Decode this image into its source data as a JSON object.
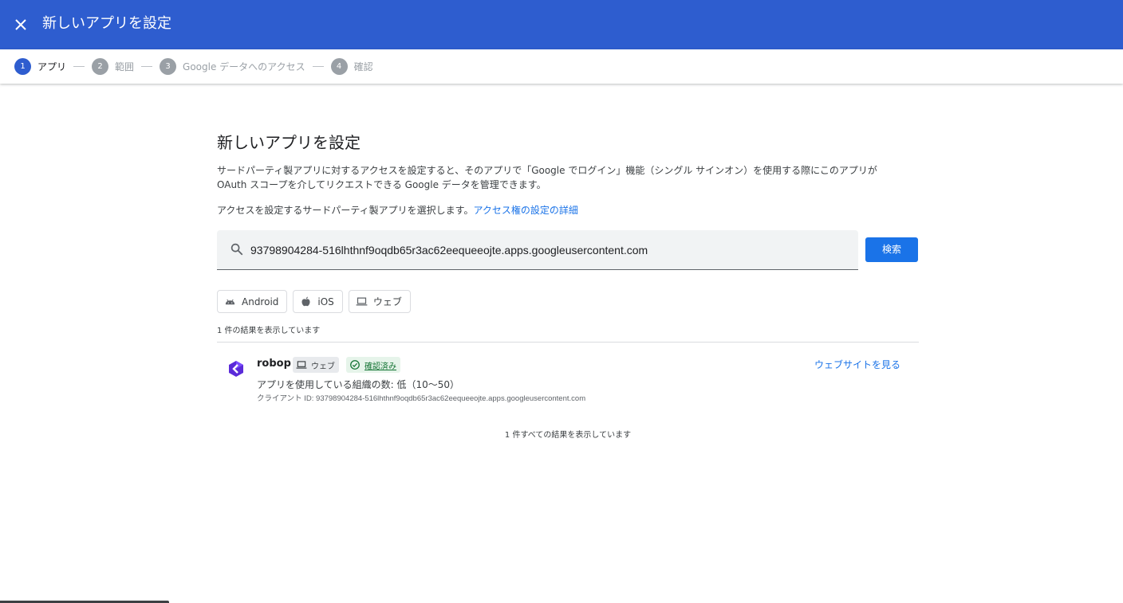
{
  "header": {
    "title": "新しいアプリを設定",
    "bg_color": "#2e5dcf"
  },
  "stepper": {
    "steps": [
      {
        "num": "1",
        "label": "アプリ",
        "active": true
      },
      {
        "num": "2",
        "label": "範囲",
        "active": false
      },
      {
        "num": "3",
        "label": "Google データへのアクセス",
        "active": false
      },
      {
        "num": "4",
        "label": "確認",
        "active": false
      }
    ]
  },
  "main": {
    "title": "新しいアプリを設定",
    "description_line1": "サードパーティ製アプリに対するアクセスを設定すると、そのアプリで「Google でログイン」機能（シングル サインオン）を使用する際にこのアプリが",
    "description_line2": "OAuth スコープを介してリクエストできる Google データを管理できます。",
    "select_text": "アクセスを設定するサードパーティ製アプリを選択します。",
    "select_link": "アクセス権の設定の詳細"
  },
  "search": {
    "value": "93798904284-516lhthnf9oqdb65r3ac62eequeeojte.apps.googleusercontent.com",
    "button_label": "検索"
  },
  "filters": [
    {
      "label": "Android",
      "icon": "android-icon"
    },
    {
      "label": "iOS",
      "icon": "apple-icon"
    },
    {
      "label": "ウェブ",
      "icon": "laptop-icon"
    }
  ],
  "result_count": "1 件の結果を表示しています",
  "results": [
    {
      "name": "robop",
      "type_badge": "ウェブ",
      "verified_badge": "確認済み",
      "org_usage": "アプリを使用している組織の数: 低（10〜50）",
      "client_label": "クライアント ID: ",
      "client_id": "93798904284-516lhthnf9oqdb65r3ac62eequeeojte.apps.googleusercontent.com",
      "visit_link": "ウェブサイトを見る"
    }
  ],
  "all_results": "1 件すべての結果を表示しています"
}
